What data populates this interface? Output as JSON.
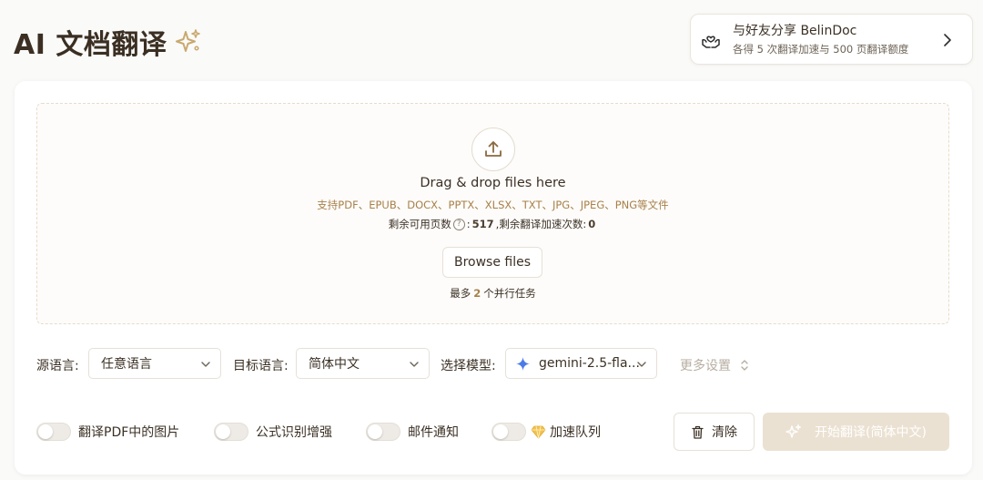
{
  "header": {
    "title": "AI 文档翻译",
    "sparkle_icon": "sparkle-icon"
  },
  "share": {
    "title": "与好友分享 BelinDoc",
    "subtitle": "各得 5 次翻译加速与 500 页翻译额度",
    "icon": "hands-heart-icon"
  },
  "upload": {
    "title": "Drag & drop files here",
    "formats": "支持PDF、EPUB、DOCX、PPTX、XLSX、TXT、JPG、JPEG、PNG等文件",
    "remaining_pages_label": "剩余可用页数",
    "remaining_pages": "517",
    "remaining_boosts_label": ",剩余翻译加速次数:",
    "remaining_boosts": "0",
    "colon": ":",
    "browse_label": "Browse files",
    "max_tasks_prefix": "最多",
    "max_tasks": "2",
    "max_tasks_suffix": "个并行任务"
  },
  "settings": {
    "source_label": "源语言:",
    "source_value": "任意语言",
    "target_label": "目标语言:",
    "target_value": "简体中文",
    "model_label": "选择模型:",
    "model_value": "gemini-2.5-fla...",
    "more_settings": "更多设置"
  },
  "options": {
    "translate_images": "翻译PDF中的图片",
    "formula_enhance": "公式识别增强",
    "email_notify": "邮件通知",
    "boost_queue": "加速队列",
    "clear_label": "清除",
    "start_label": "开始翻译(简体中文)"
  },
  "colors": {
    "accent": "#a8804a",
    "primary_disabled": "#ebe1d2",
    "text": "#3b3024"
  }
}
